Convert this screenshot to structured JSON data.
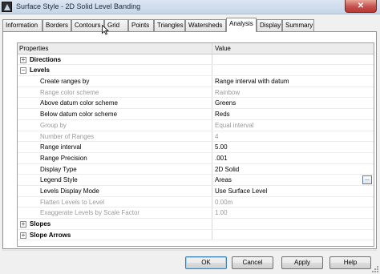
{
  "window": {
    "title": "Surface Style - 2D Solid Level Banding",
    "close_label": "✕"
  },
  "tabs": [
    {
      "label": "Information",
      "active": false
    },
    {
      "label": "Borders",
      "active": false
    },
    {
      "label": "Contours",
      "active": false
    },
    {
      "label": "Grid",
      "active": false
    },
    {
      "label": "Points",
      "active": false
    },
    {
      "label": "Triangles",
      "active": false
    },
    {
      "label": "Watersheds",
      "active": false
    },
    {
      "label": "Analysis",
      "active": true
    },
    {
      "label": "Display",
      "active": false
    },
    {
      "label": "Summary",
      "active": false
    }
  ],
  "grid": {
    "header": {
      "property": "Properties",
      "value": "Value"
    },
    "rows": [
      {
        "kind": "group",
        "label": "Directions",
        "expander": "+"
      },
      {
        "kind": "group",
        "label": "Levels",
        "expander": "−"
      },
      {
        "kind": "prop",
        "label": "Create ranges by",
        "value": "Range interval with datum",
        "enabled": true
      },
      {
        "kind": "prop",
        "label": "Range color scheme",
        "value": "Rainbow",
        "enabled": false
      },
      {
        "kind": "prop",
        "label": "Above datum color scheme",
        "value": "Greens",
        "enabled": true
      },
      {
        "kind": "prop",
        "label": "Below datum color scheme",
        "value": "Reds",
        "enabled": true
      },
      {
        "kind": "prop",
        "label": "Group by",
        "value": "Equal interval",
        "enabled": false
      },
      {
        "kind": "prop",
        "label": "Number of Ranges",
        "value": "4",
        "enabled": false
      },
      {
        "kind": "prop",
        "label": "Range interval",
        "value": "5.00",
        "enabled": true
      },
      {
        "kind": "prop",
        "label": "Range Precision",
        "value": ".001",
        "enabled": true
      },
      {
        "kind": "prop",
        "label": "Display Type",
        "value": "2D Solid",
        "enabled": true
      },
      {
        "kind": "prop",
        "label": "Legend Style",
        "value": "Areas",
        "enabled": true,
        "button": "..."
      },
      {
        "kind": "prop",
        "label": "Levels Display Mode",
        "value": "Use Surface Level",
        "enabled": true
      },
      {
        "kind": "prop",
        "label": "Flatten Levels to Level",
        "value": "0.00m",
        "enabled": false
      },
      {
        "kind": "prop",
        "label": "Exaggerate Levels by Scale Factor",
        "value": "1.00",
        "enabled": false
      },
      {
        "kind": "group",
        "label": "Slopes",
        "expander": "+"
      },
      {
        "kind": "group",
        "label": "Slope Arrows",
        "expander": "+"
      }
    ]
  },
  "buttons": {
    "ok": "OK",
    "cancel": "Cancel",
    "apply": "Apply",
    "help": "Help"
  }
}
